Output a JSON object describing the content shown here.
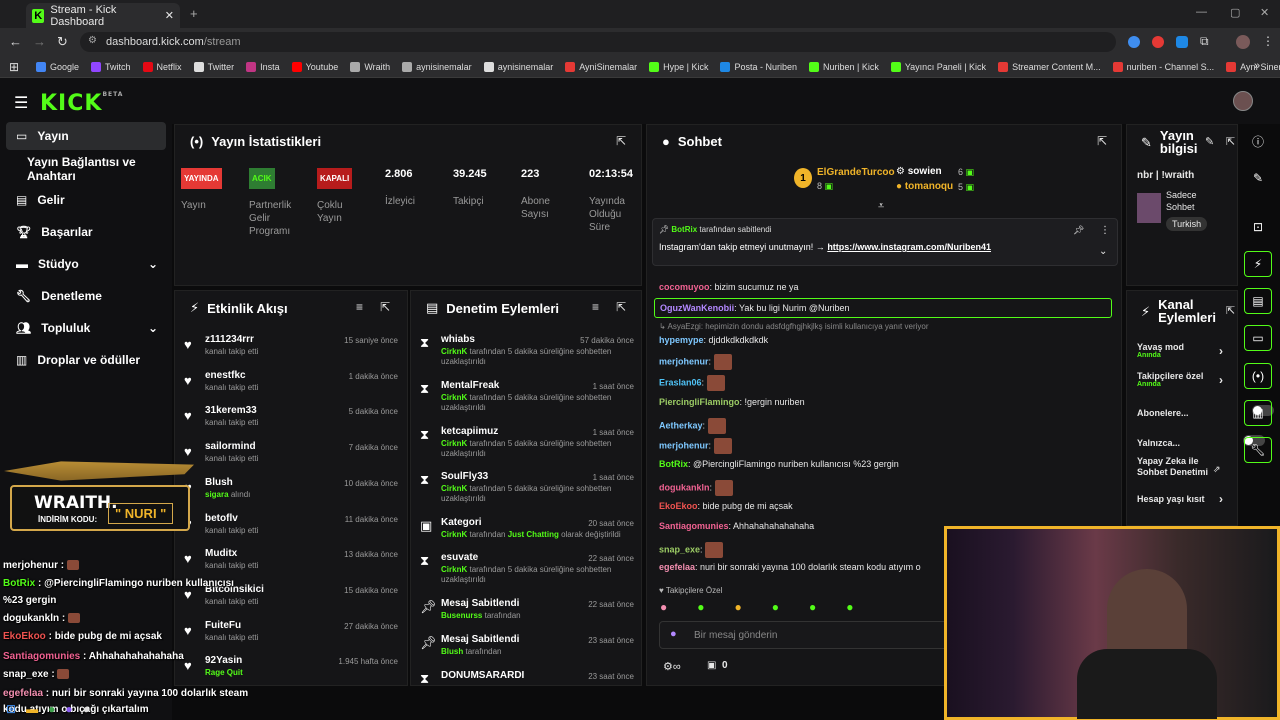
{
  "browser": {
    "tab_title": "Stream - Kick Dashboard",
    "url_host": "dashboard.kick.com",
    "url_path": "/stream",
    "bookmarks": [
      "Google",
      "Twitch",
      "Netflix",
      "Twitter",
      "Insta",
      "Youtube",
      "Wraith",
      "aynisinemalar",
      "aynisinemalar",
      "AyniSinemalar",
      "Hype | Kick",
      "Posta - Nuriben",
      "Nuriben | Kick",
      "Yayıncı Paneli | Kick",
      "Streamer Content M...",
      "nuriben - Channel S...",
      "Aynı Sinemalar - Ça..."
    ]
  },
  "app": {
    "logo": "KICK",
    "beta": "BETA"
  },
  "sidebar": {
    "items": [
      {
        "label": "Yayın"
      },
      {
        "label": "Yayın Bağlantısı ve Anahtarı"
      },
      {
        "label": "Gelir"
      },
      {
        "label": "Başarılar"
      },
      {
        "label": "Stüdyo"
      },
      {
        "label": "Denetleme"
      },
      {
        "label": "Topluluk"
      },
      {
        "label": "Droplar ve ödüller"
      }
    ]
  },
  "stats": {
    "title": "Yayın İstatistikleri",
    "live_badge": "YAYINDA",
    "live_label": "Yayın",
    "partner_badge": "ACIK",
    "partner_label": "Partnerlik Gelir Programı",
    "multi_badge": "KAPALI",
    "multi_label": "Çoklu Yayın",
    "viewers": "2.806",
    "viewers_label": "İzleyici",
    "followers": "39.245",
    "followers_label": "Takipçi",
    "subs": "223",
    "subs_label": "Abone Sayısı",
    "uptime": "02:13:54",
    "uptime_label": "Yayında Olduğu Süre"
  },
  "activity": {
    "title": "Etkinlik Akışı",
    "rows": [
      {
        "name": "z111234rrr",
        "sub": "kanalı takip etti",
        "time": "15 saniye önce"
      },
      {
        "name": "enestfkc",
        "sub": "kanalı takip etti",
        "time": "1 dakika önce"
      },
      {
        "name": "31kerem33",
        "sub": "kanalı takip etti",
        "time": "5 dakika önce"
      },
      {
        "name": "sailormind",
        "sub": "kanalı takip etti",
        "time": "7 dakika önce"
      },
      {
        "name": "Blush",
        "sub_hl": "sigara",
        "sub": "alındı",
        "time": "10 dakika önce"
      },
      {
        "name": "betoflv",
        "sub": "kanalı takip etti",
        "time": "11 dakika önce"
      },
      {
        "name": "Muditx",
        "sub": "kanalı takip etti",
        "time": "13 dakika önce"
      },
      {
        "name": "Bitcoinsikici",
        "sub": "kanalı takip etti",
        "time": "15 dakika önce"
      },
      {
        "name": "FuiteFu",
        "sub": "kanalı takip etti",
        "time": "27 dakika önce"
      },
      {
        "name": "92Yasin",
        "sub_hl": "Rage Quit",
        "sub": "",
        "time": "1.945 hafta önce"
      }
    ]
  },
  "moderation": {
    "title": "Denetim Eylemleri",
    "rows": [
      {
        "name": "whiabs",
        "by": "CirknK",
        "sub": "tarafından 5 dakika süreliğine sohbetten uzaklaştırıldı",
        "time": "57 dakika önce"
      },
      {
        "name": "MentalFreak",
        "by": "CirknK",
        "sub": "tarafından 5 dakika süreliğine sohbetten uzaklaştırıldı",
        "time": "1 saat önce"
      },
      {
        "name": "ketcapiimuz",
        "by": "CirknK",
        "sub": "tarafından 5 dakika süreliğine sohbetten uzaklaştırıldı",
        "time": "1 saat önce"
      },
      {
        "name": "SoulFly33",
        "by": "CirknK",
        "sub": "tarafından 5 dakika süreliğine sohbetten uzaklaştırıldı",
        "time": "1 saat önce"
      },
      {
        "name": "Kategori",
        "by": "CirknK",
        "sub": "tarafından",
        "hl2": "Just Chatting",
        "sub2": "olarak değiştirildi",
        "time": "20 saat önce"
      },
      {
        "name": "esuvate",
        "by": "CirknK",
        "sub": "tarafından 5 dakika süreliğine sohbetten uzaklaştırıldı",
        "time": "22 saat önce"
      },
      {
        "name": "Mesaj Sabitlendi",
        "by": "Busenurss",
        "sub": "tarafından",
        "time": "22 saat önce"
      },
      {
        "name": "Mesaj Sabitlendi",
        "by": "Blush",
        "sub": "tarafından",
        "time": "23 saat önce"
      },
      {
        "name": "DONUMSARARDI",
        "by": "",
        "sub": "",
        "time": "23 saat önce"
      }
    ]
  },
  "chat": {
    "title": "Sohbet",
    "leaders": [
      {
        "name": "ElGrandeTurcoo",
        "count": "8",
        "rank": "1"
      },
      {
        "name": "sowien",
        "count": "6"
      },
      {
        "name": "tomanoqu",
        "count": "5"
      }
    ],
    "pinned_by": "BotRix",
    "pinned_suffix": "tarafından sabitlendi",
    "pinned_text": "Instagram'dan takip etmeyi unutmayın! →",
    "pinned_link": "https://www.instagram.com/Nuriben41",
    "messages": [
      {
        "user": "cocomuyoo",
        "color": "#f06292",
        "text": "bizim sucumuz ne ya"
      },
      {
        "user": "OguzWanKenobii",
        "color": "#b388ff",
        "text": "Yak bu ligi Nurim @Nuriben"
      },
      {
        "reply": "AsyaEzgi: hepimizin dondu adsfdgfhgjhkjlkş isimli kullanıcıya yanıt veriyor"
      },
      {
        "user": "hypemype",
        "color": "#7ec8ff",
        "text": "djddkdkdkdkdk"
      },
      {
        "user": "merjohenur",
        "color": "#7ec8ff",
        "text": ""
      },
      {
        "user": "Eraslan06",
        "color": "#4fc3f7",
        "text": ""
      },
      {
        "user": "PiercingliFlamingo",
        "color": "#9ccc65",
        "text": "!gergin nuriben"
      },
      {
        "user": "Aetherkay",
        "color": "#7ec8ff",
        "text": ""
      },
      {
        "user": "merjohenur",
        "color": "#7ec8ff",
        "text": ""
      },
      {
        "user": "BotRix",
        "color": "#53fc18",
        "text": "@PiercingliFlamingo nuriben kullanıcısı %23 gergin"
      },
      {
        "user": "dogukankln",
        "color": "#f06292",
        "text": ""
      },
      {
        "user": "EkoEkoo",
        "color": "#ef5350",
        "text": "bide pubg de mi açsak"
      },
      {
        "user": "Santiagomunies",
        "color": "#f06292",
        "text": "Ahhahahahahahaha"
      },
      {
        "user": "snap_exe",
        "color": "#9ccc65",
        "text": ""
      },
      {
        "user": "egefelaa",
        "color": "#f48fb1",
        "text": "nuri bir sonraki yayına 100 dolarlık steam kodu atıyım o"
      }
    ],
    "followers_only": "Takipçilere Özel",
    "placeholder": "Bir mesaj gönderin",
    "counter": "0"
  },
  "stream_info": {
    "title": "Yayın bilgisi",
    "stream_title": "nbr | !wraith",
    "category": "Sadece Sohbet",
    "language": "Turkish"
  },
  "channel_actions": {
    "title": "Kanal Eylemleri",
    "slow": "Yavaş mod",
    "slow_sub": "Anında",
    "followers": "Takipçilere özel",
    "followers_sub": "Anında",
    "subs": "Abonelere...",
    "emotes": "Yalnızca...",
    "ai": "Yapay Zeka ile Sohbet Denetimi",
    "age": "Hesap yaşı kısıt"
  },
  "overlay": {
    "brand": "WRAITH.",
    "code_label": "İNDİRİM KODU:",
    "code": "\" NURI \"",
    "lines": [
      {
        "user": "merjohenur",
        "color": "#ffffff",
        "text": ""
      },
      {
        "user": "BotRix",
        "color": "#53fc18",
        "text": "@PiercingliFlamingo nuriben kullanıcısı"
      },
      {
        "user": "",
        "color": "#ffffff",
        "text": "%23 gergin"
      },
      {
        "user": "dogukankln",
        "color": "#ffffff",
        "text": ""
      },
      {
        "user": "EkoEkoo",
        "color": "#ef5350",
        "text": "bide pubg de mi açsak"
      },
      {
        "user": "Santiagomunies",
        "color": "#f06292",
        "text": "Ahhahahahahahaha"
      },
      {
        "user": "snap_exe",
        "color": "#ffffff",
        "text": ""
      },
      {
        "user": "egefelaa",
        "color": "#f48fb1",
        "text": "nuri bir sonraki yayına 100 dolarlık steam"
      },
      {
        "user": "",
        "color": "#ffffff",
        "text": "kodu atıyım o bıçağı çıkartalım"
      }
    ]
  }
}
